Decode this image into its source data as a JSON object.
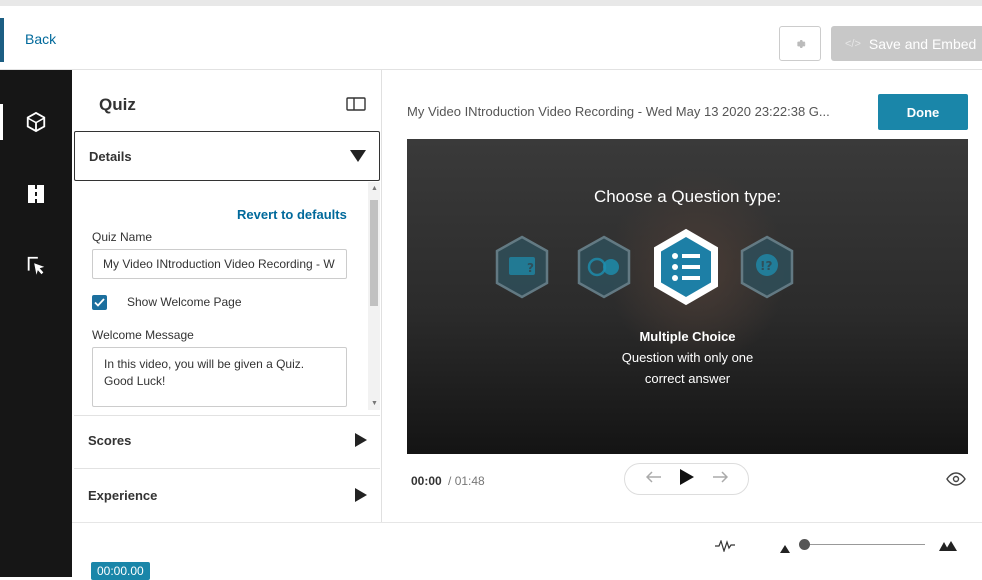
{
  "header": {
    "back_label": "Back",
    "save_embed_label": "Save and Embed",
    "save_embed_code_glyph": "</>"
  },
  "rail": {
    "items": [
      {
        "icon": "cube-icon",
        "active": true
      },
      {
        "icon": "split-icon",
        "active": false
      },
      {
        "icon": "cursor-select-icon",
        "active": false
      }
    ]
  },
  "panel": {
    "title": "Quiz",
    "sections": {
      "details": "Details",
      "scores": "Scores",
      "experience": "Experience"
    },
    "details": {
      "revert_label": "Revert to defaults",
      "quiz_name_label": "Quiz Name",
      "quiz_name_value": "My Video INtroduction Video Recording - W",
      "show_welcome_label": "Show Welcome Page",
      "show_welcome_checked": true,
      "welcome_message_label": "Welcome Message",
      "welcome_message_value": "In this video, you will be given a Quiz. Good Luck!"
    }
  },
  "main": {
    "video_title": "My Video INtroduction Video Recording - Wed May 13 2020 23:22:38 G...",
    "done_label": "Done",
    "player": {
      "heading": "Choose a Question type:",
      "question_types": [
        {
          "icon": "reflection-point-icon",
          "selected": false
        },
        {
          "icon": "true-false-icon",
          "selected": false
        },
        {
          "icon": "multiple-choice-icon",
          "selected": true
        },
        {
          "icon": "open-question-icon",
          "selected": false
        }
      ],
      "selected_title": "Multiple Choice",
      "selected_desc_line1": "Question with only one",
      "selected_desc_line2": "correct answer"
    },
    "time_current": "00:00",
    "time_separator": "/",
    "time_total": "01:48"
  },
  "timeline": {
    "timecode": "00:00.00"
  },
  "colors": {
    "accent": "#1a86a9",
    "link": "#00699b",
    "rail": "#161616",
    "disabled_button": "#c8c8c8"
  }
}
